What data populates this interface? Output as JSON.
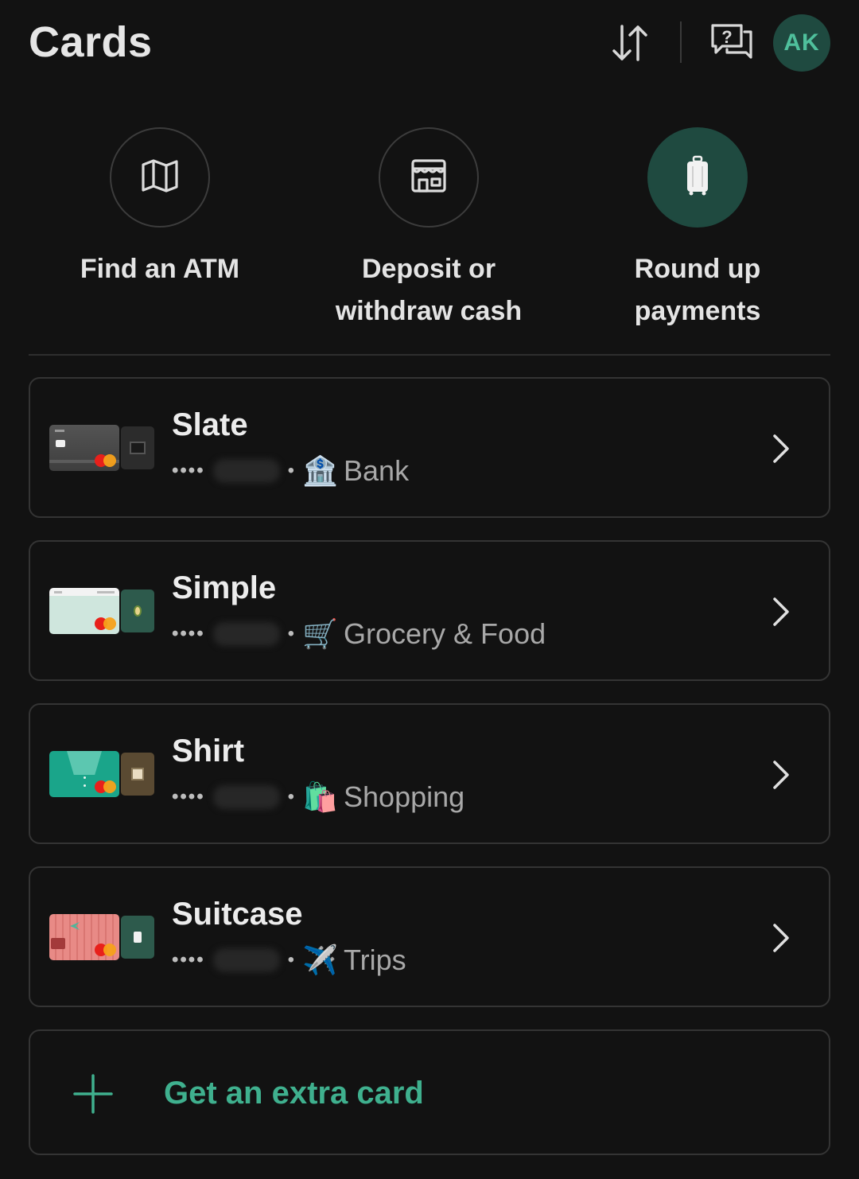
{
  "header": {
    "title": "Cards",
    "avatar_initials": "AK"
  },
  "quick_actions": [
    {
      "label": "Find an ATM",
      "icon": "map-icon",
      "active": false
    },
    {
      "label": "Deposit or\nwithdraw cash",
      "icon": "store-icon",
      "active": false
    },
    {
      "label": "Round up\npayments",
      "icon": "suitcase-icon",
      "active": true
    }
  ],
  "cards": [
    {
      "name": "Slate",
      "masked_number": "••••",
      "category_icon": "🏦",
      "category": "Bank"
    },
    {
      "name": "Simple",
      "masked_number": "••••",
      "category_icon": "🛒",
      "category": "Grocery & Food"
    },
    {
      "name": "Shirt",
      "masked_number": "••••",
      "category_icon": "🛍️",
      "category": "Shopping"
    },
    {
      "name": "Suitcase",
      "masked_number": "••••",
      "category_icon": "✈️",
      "category": "Trips"
    }
  ],
  "add_card": {
    "label": "Get an extra card"
  },
  "colors": {
    "background": "#121212",
    "accent": "#3fb08e",
    "accent_dark": "#1f4a40"
  }
}
